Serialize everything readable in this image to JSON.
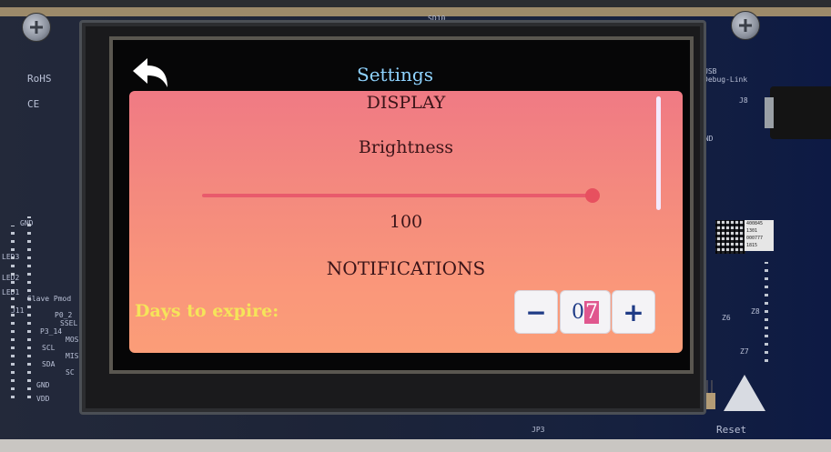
{
  "board": {
    "silk_top": "SD10",
    "silk_usb": "USB\nDebug-Link",
    "silk_j8": "J8",
    "silk_gnd": "GND",
    "silk_rohs": "RoHS",
    "silk_ce": "CE",
    "silk_gnd_left": "GND",
    "silk_led3": "LED3",
    "silk_led2": "LED2",
    "silk_led1": "LED1",
    "silk_j11": "J11",
    "silk_slave": "Slave Pmod",
    "silk_p02": "P0_2",
    "silk_ssel": "SSEL",
    "silk_p3_14": "P3_14",
    "silk_mos": "MOS",
    "silk_scl": "SCL",
    "silk_mis": "MIS",
    "silk_sda": "SDA",
    "silk_sc": "SC",
    "silk_gnd_bottom": "GND",
    "silk_vdd": "VDD",
    "silk_jp3": "JP3",
    "silk_reset": "Reset",
    "silk_z8": "Z8",
    "silk_z6": "Z6",
    "silk_z7": "Z7",
    "label_lines": [
      "400845",
      "1301",
      "000777",
      "1815"
    ]
  },
  "app": {
    "title": "Settings",
    "back_icon": "back-arrow-icon",
    "display_section": "DISPLAY",
    "brightness_label": "Brightness",
    "brightness_value": "100",
    "brightness_fraction": 1.0,
    "notifications_section": "NOTIFICATIONS",
    "days_label": "Days to expire:",
    "days_value_prefix": "0",
    "days_value_cursor": "7",
    "minus_label": "−",
    "plus_label": "+"
  },
  "colors": {
    "title": "#8fd3ff",
    "days_label": "#f5e45a",
    "stepper_icon": "#1f3b86",
    "slider": "#e95a6c"
  }
}
